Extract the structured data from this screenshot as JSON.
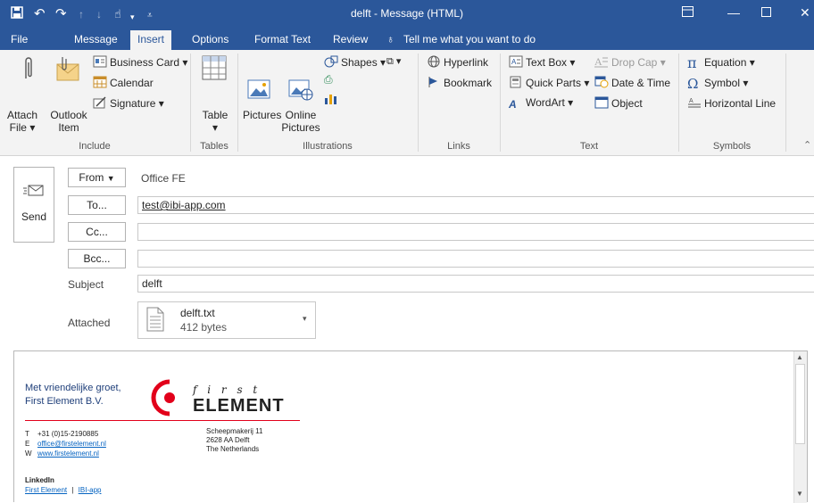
{
  "window": {
    "title": "delft  -  Message (HTML)"
  },
  "tabs": [
    "File",
    "Message",
    "Insert",
    "Options",
    "Format Text",
    "Review"
  ],
  "tell_me": "Tell me what you want to do",
  "ribbon": {
    "include": {
      "attach_file": [
        "Attach",
        "File"
      ],
      "outlook_item": [
        "Outlook",
        "Item"
      ],
      "business_card": "Business Card",
      "calendar": "Calendar",
      "signature": "Signature",
      "label": "Include"
    },
    "tables": {
      "table": "Table",
      "label": "Tables"
    },
    "illustrations": {
      "pictures": "Pictures",
      "online_pictures": [
        "Online",
        "Pictures"
      ],
      "shapes": "Shapes",
      "label": "Illustrations"
    },
    "links": {
      "hyperlink": "Hyperlink",
      "bookmark": "Bookmark",
      "label": "Links"
    },
    "text": {
      "text_box": "Text Box",
      "drop_cap": "Drop Cap",
      "quick_parts": "Quick Parts",
      "date_time": "Date & Time",
      "wordart": "WordArt",
      "object": "Object",
      "label": "Text"
    },
    "symbols": {
      "equation": "Equation",
      "symbol": "Symbol",
      "horizontal_line": "Horizontal Line",
      "label": "Symbols"
    }
  },
  "compose": {
    "send": "Send",
    "from_btn": "From",
    "from_value": "Office FE",
    "to_btn": "To...",
    "to_value": "test@ibi-app.com",
    "cc_btn": "Cc...",
    "cc_value": "",
    "bcc_btn": "Bcc...",
    "bcc_value": "",
    "subject_label": "Subject",
    "subject_value": "delft",
    "attached_label": "Attached",
    "attachment": {
      "name": "delft.txt",
      "size": "412 bytes"
    }
  },
  "signature": {
    "greeting": "Met vriendelijke groet,",
    "company": "First Element B.V.",
    "logo_top": "f  i  r  s  t",
    "logo_bottom": "ELEMENT",
    "phone_key": "T",
    "phone": "+31 (0)15-2190885",
    "email_key": "E",
    "email": "office@firstelement.nl",
    "web_key": "W",
    "web": "www.firstelement.nl",
    "address": [
      "Scheepmakerij 11",
      "2628 AA  Delft",
      "The Netherlands"
    ],
    "linkedin_label": "LinkedIn",
    "linkedin_links": [
      "First Element",
      "IBI-app"
    ],
    "linkedin_sep": "|"
  },
  "colors": {
    "titlebar": "#2b579a",
    "logo_red": "#e2001a",
    "link": "#0563c1"
  }
}
